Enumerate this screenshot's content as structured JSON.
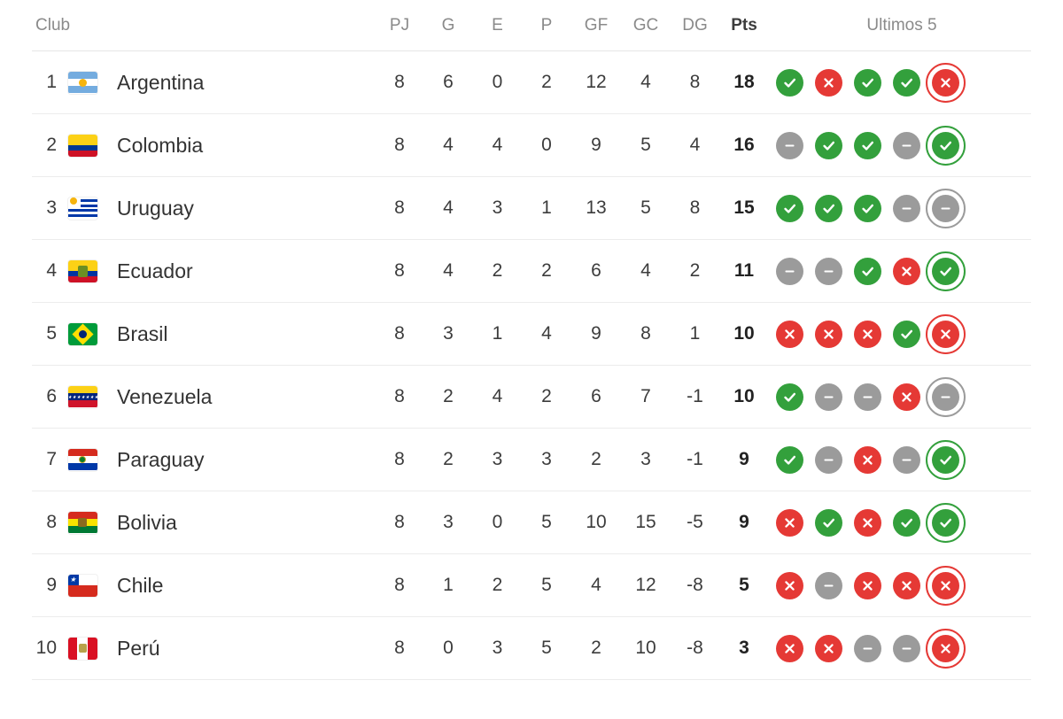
{
  "table": {
    "columns": {
      "club": "Club",
      "pj": "PJ",
      "g": "G",
      "e": "E",
      "p": "P",
      "gf": "GF",
      "gc": "GC",
      "dg": "DG",
      "pts": "Pts",
      "last5": "Ultimos 5"
    },
    "legend": {
      "win": "win-icon",
      "loss": "loss-icon",
      "draw": "draw-icon"
    },
    "colors": {
      "win": "#33a03c",
      "loss": "#e53935",
      "draw": "#9b9b9b",
      "header_text": "#8a8a8a",
      "body_text": "#3c3c3c",
      "row_divider": "#ececec"
    },
    "rows": [
      {
        "pos": "1",
        "club": "Argentina",
        "flag": "flag-argentina",
        "pj": "8",
        "g": "6",
        "e": "0",
        "p": "2",
        "gf": "12",
        "gc": "4",
        "dg": "8",
        "pts": "18",
        "last5": [
          "win",
          "loss",
          "win",
          "win",
          "loss"
        ]
      },
      {
        "pos": "2",
        "club": "Colombia",
        "flag": "flag-colombia",
        "pj": "8",
        "g": "4",
        "e": "4",
        "p": "0",
        "gf": "9",
        "gc": "5",
        "dg": "4",
        "pts": "16",
        "last5": [
          "draw",
          "win",
          "win",
          "draw",
          "win"
        ]
      },
      {
        "pos": "3",
        "club": "Uruguay",
        "flag": "flag-uruguay",
        "pj": "8",
        "g": "4",
        "e": "3",
        "p": "1",
        "gf": "13",
        "gc": "5",
        "dg": "8",
        "pts": "15",
        "last5": [
          "win",
          "win",
          "win",
          "draw",
          "draw"
        ]
      },
      {
        "pos": "4",
        "club": "Ecuador",
        "flag": "flag-ecuador",
        "pj": "8",
        "g": "4",
        "e": "2",
        "p": "2",
        "gf": "6",
        "gc": "4",
        "dg": "2",
        "pts": "11",
        "last5": [
          "draw",
          "draw",
          "win",
          "loss",
          "win"
        ]
      },
      {
        "pos": "5",
        "club": "Brasil",
        "flag": "flag-brasil",
        "pj": "8",
        "g": "3",
        "e": "1",
        "p": "4",
        "gf": "9",
        "gc": "8",
        "dg": "1",
        "pts": "10",
        "last5": [
          "loss",
          "loss",
          "loss",
          "win",
          "loss"
        ]
      },
      {
        "pos": "6",
        "club": "Venezuela",
        "flag": "flag-venezuela",
        "pj": "8",
        "g": "2",
        "e": "4",
        "p": "2",
        "gf": "6",
        "gc": "7",
        "dg": "-1",
        "pts": "10",
        "last5": [
          "win",
          "draw",
          "draw",
          "loss",
          "draw"
        ]
      },
      {
        "pos": "7",
        "club": "Paraguay",
        "flag": "flag-paraguay",
        "pj": "8",
        "g": "2",
        "e": "3",
        "p": "3",
        "gf": "2",
        "gc": "3",
        "dg": "-1",
        "pts": "9",
        "last5": [
          "win",
          "draw",
          "loss",
          "draw",
          "win"
        ]
      },
      {
        "pos": "8",
        "club": "Bolivia",
        "flag": "flag-bolivia",
        "pj": "8",
        "g": "3",
        "e": "0",
        "p": "5",
        "gf": "10",
        "gc": "15",
        "dg": "-5",
        "pts": "9",
        "last5": [
          "loss",
          "win",
          "loss",
          "win",
          "win"
        ]
      },
      {
        "pos": "9",
        "club": "Chile",
        "flag": "flag-chile",
        "pj": "8",
        "g": "1",
        "e": "2",
        "p": "5",
        "gf": "4",
        "gc": "12",
        "dg": "-8",
        "pts": "5",
        "last5": [
          "loss",
          "draw",
          "loss",
          "loss",
          "loss"
        ]
      },
      {
        "pos": "10",
        "club": "Perú",
        "flag": "flag-peru",
        "pj": "8",
        "g": "0",
        "e": "3",
        "p": "5",
        "gf": "2",
        "gc": "10",
        "dg": "-8",
        "pts": "3",
        "last5": [
          "loss",
          "loss",
          "draw",
          "draw",
          "loss"
        ]
      }
    ]
  }
}
